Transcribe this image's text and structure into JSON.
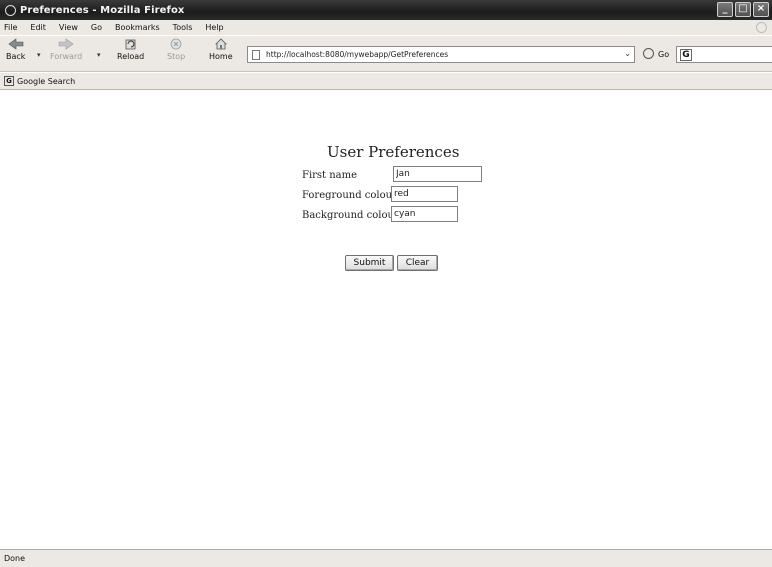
{
  "window": {
    "title": "Preferences - Mozilla Firefox",
    "controls": [
      "minimize",
      "maximize",
      "close"
    ]
  },
  "menubar": {
    "items": [
      "File",
      "Edit",
      "View",
      "Go",
      "Bookmarks",
      "Tools",
      "Help"
    ]
  },
  "navigation": {
    "back_label": "Back",
    "forward_label": "Forward",
    "reload_label": "Reload",
    "stop_label": "Stop",
    "home_label": "Home",
    "address": "http://localhost:8080/mywebapp/GetPreferences",
    "go_label": "Go",
    "search_value": ""
  },
  "google_toolbar": {
    "label": "Google Search"
  },
  "page": {
    "heading": "User Preferences",
    "fields": [
      {
        "label": "First name",
        "value": "Jan"
      },
      {
        "label": "Foreground colour",
        "value": "red"
      },
      {
        "label": "Background colour",
        "value": "cyan"
      }
    ],
    "submit_label": "Submit",
    "clear_label": "Clear"
  },
  "status": {
    "text": "Done"
  }
}
